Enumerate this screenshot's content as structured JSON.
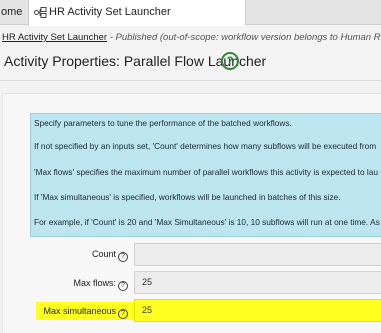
{
  "tabs": {
    "home_label": "ome",
    "active_label": "HR Activity Set Launcher"
  },
  "breadcrumb": {
    "name": "HR Activity Set Launcher",
    "meta": " - Published  (out-of-scope: workflow version belongs to Human Resources: "
  },
  "page": {
    "title": "Activity Properties: Parallel Flow Launcher",
    "help_symbol": "?"
  },
  "info": {
    "lines": [
      "Specify parameters to tune the performance of the batched workflows.",
      "If not specified by an inputs set, 'Count' determines how many subflows will be executed from",
      "'Max flows' specifies the maximum number of parallel workflows this activity is expected to lau",
      "If 'Max simultaneous' is specified, workflows will be launched in batches of this size.",
      "For example, if 'Count' is 20 and 'Max Simultaneous' is 10, 10 subflows will run at one time. As"
    ]
  },
  "fields": {
    "count_label": "Count",
    "count_value": "",
    "max_flows_label": "Max flows:",
    "max_flows_value": "25",
    "max_simultaneous_label": "Max simultaneous",
    "max_simultaneous_value": "25",
    "help_symbol": "?"
  },
  "colors": {
    "info_background": "#bde5ef",
    "highlight": "#ffff1f",
    "help_icon_green": "#2f8a3b"
  }
}
